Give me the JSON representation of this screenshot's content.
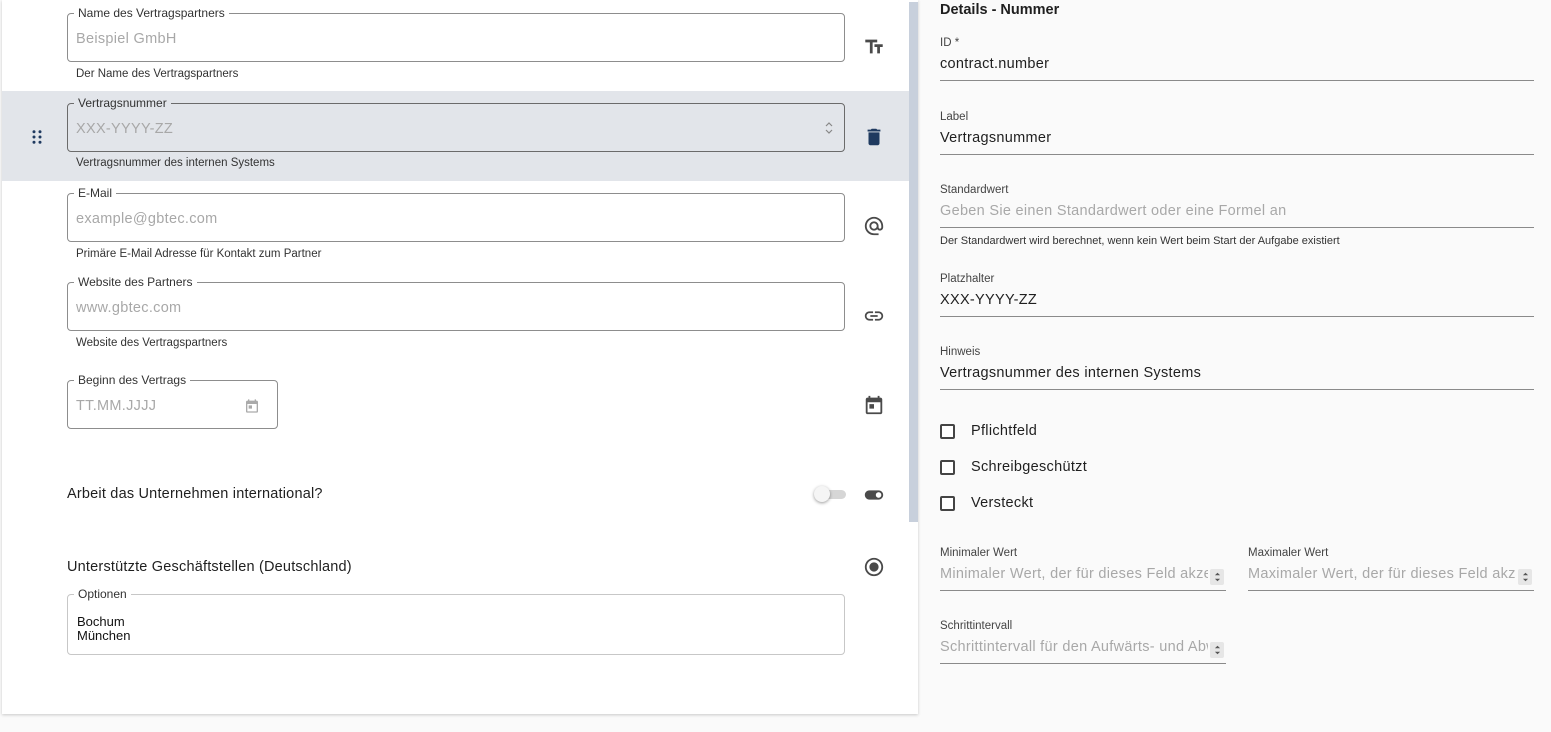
{
  "form_fields": [
    {
      "label": "Name des Vertragspartners",
      "placeholder": "Beispiel GmbH",
      "hint": "Der Name des Vertragspartners",
      "type_icon": "text-fields-icon"
    },
    {
      "label": "Vertragsnummer",
      "placeholder": "XXX-YYYY-ZZ",
      "hint": "Vertragsnummer des internen Systems",
      "type_icon": "delete-icon",
      "selected": true
    },
    {
      "label": "E-Mail",
      "placeholder": "example@gbtec.com",
      "hint": "Primäre E-Mail Adresse für Kontakt zum Partner",
      "type_icon": "at-sign-icon"
    },
    {
      "label": "Website des Partners",
      "placeholder": "www.gbtec.com",
      "hint": "Website des Vertragspartners",
      "type_icon": "link-icon"
    },
    {
      "label": "Beginn des Vertrags",
      "placeholder": "TT.MM.JJJJ",
      "type_icon": "calendar-icon"
    }
  ],
  "toggle_question": {
    "text": "Arbeit das Unternehmen international?",
    "type_icon": "toggle-icon",
    "value": false
  },
  "radio_question": {
    "text": "Unterstützte Geschäftstellen (Deutschland)",
    "type_icon": "radio-button-icon",
    "options_label": "Optionen",
    "options": [
      "Bochum",
      "München"
    ]
  },
  "details": {
    "title": "Details - Nummer",
    "id": {
      "label": "ID *",
      "value": "contract.number"
    },
    "label": {
      "label": "Label",
      "value": "Vertragsnummer"
    },
    "default": {
      "label": "Standardwert",
      "placeholder": "Geben Sie einen Standardwert oder eine Formel an",
      "hint": "Der Standardwert wird berechnet, wenn kein Wert beim Start der Aufgabe existiert"
    },
    "placeholder": {
      "label": "Platzhalter",
      "value": "XXX-YYYY-ZZ"
    },
    "hint": {
      "label": "Hinweis",
      "value": "Vertragsnummer des internen Systems"
    },
    "checkboxes": [
      {
        "label": "Pflichtfeld",
        "checked": false
      },
      {
        "label": "Schreibgeschützt",
        "checked": false
      },
      {
        "label": "Versteckt",
        "checked": false
      }
    ],
    "min": {
      "label": "Minimaler Wert",
      "placeholder": "Minimaler Wert, der für dieses Feld akzeptiert wird"
    },
    "max": {
      "label": "Maximaler Wert",
      "placeholder": "Maximaler Wert, der für dieses Feld akzeptiert wird"
    },
    "step": {
      "label": "Schrittintervall",
      "placeholder": "Schrittintervall für den Aufwärts- und Abwärtspfeil"
    }
  },
  "colors": {
    "selected_row": "#e2e5ea",
    "accent_dark": "#1f3a60",
    "scrollbar": "#c8d0dc"
  }
}
